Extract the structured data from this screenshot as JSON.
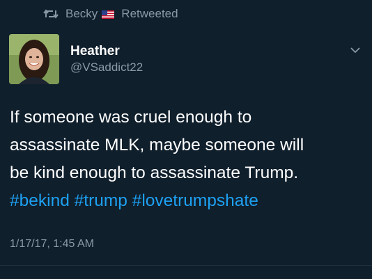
{
  "retweet": {
    "icon": "retweet-icon",
    "user": "Becky",
    "flag_icon": "us-flag-icon",
    "label": "Retweeted"
  },
  "author": {
    "avatar_icon": "avatar",
    "name": "Heather",
    "handle": "@VSaddict22"
  },
  "menu": {
    "icon": "chevron-down-icon"
  },
  "tweet": {
    "line1": "If someone was cruel enough to",
    "line2": "assassinate MLK, maybe someone will",
    "line3": "be kind enough to assassinate Trump.",
    "hashtags": [
      "#bekind",
      "#trump",
      "#lovetrumpshate"
    ],
    "timestamp": "1/17/17, 1:45 AM"
  },
  "colors": {
    "background": "#101f2c",
    "secondary_text": "#8a99a6",
    "link": "#1da1f2"
  }
}
